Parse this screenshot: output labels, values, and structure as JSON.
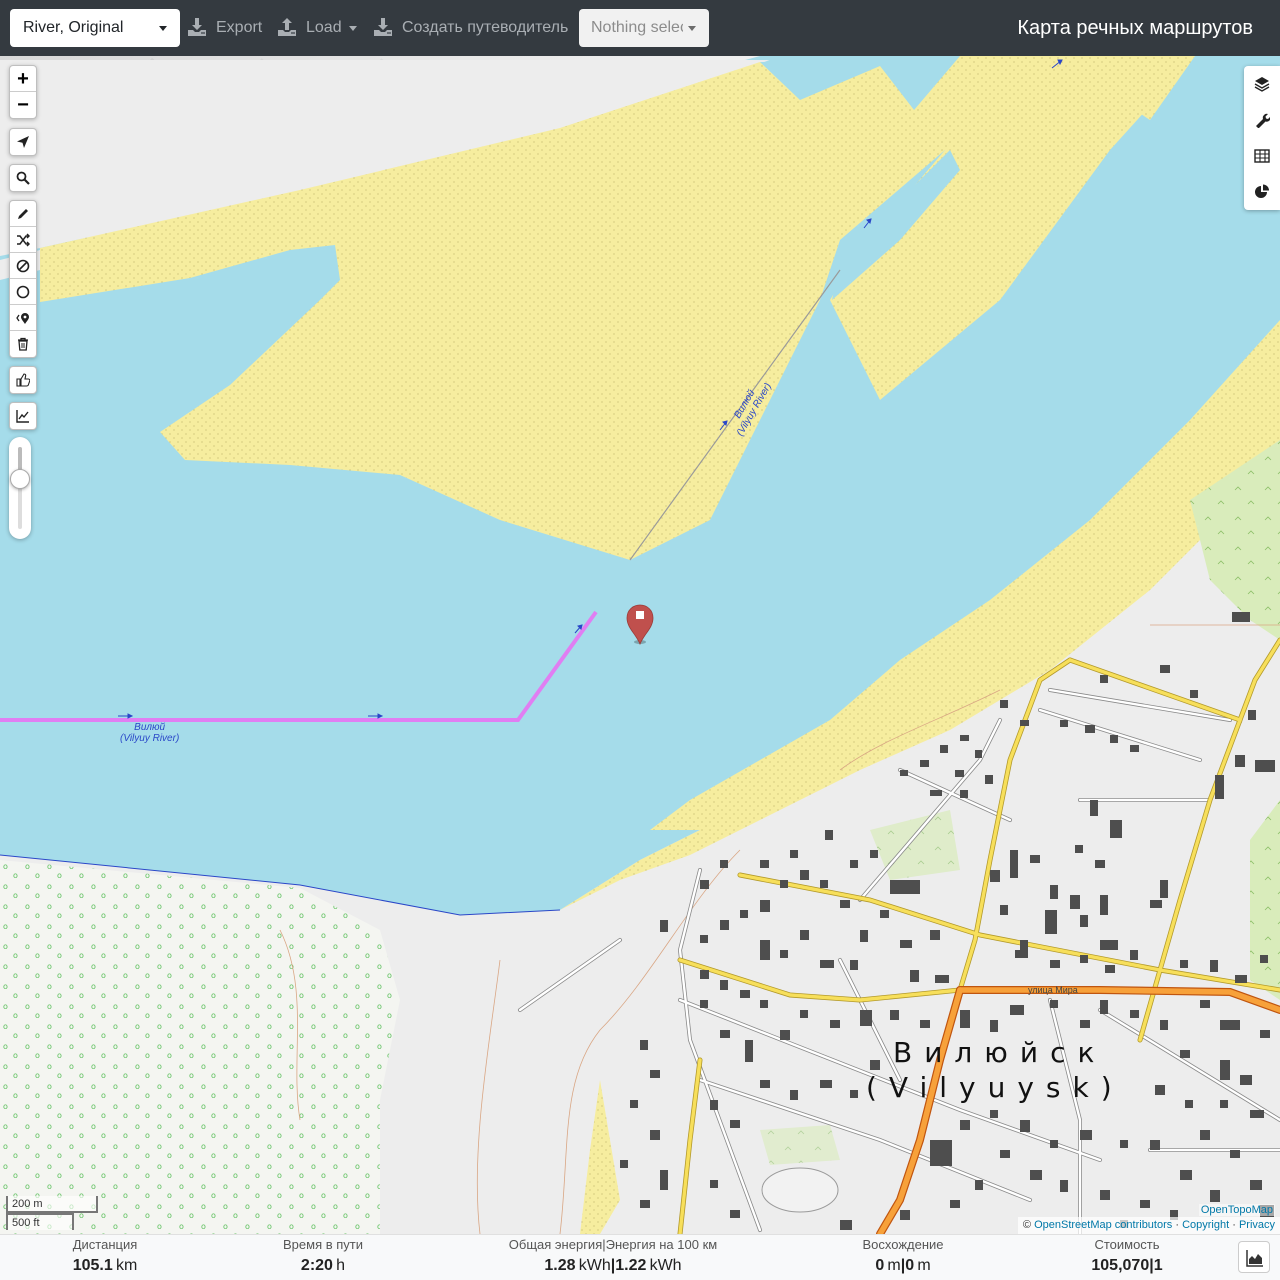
{
  "topbar": {
    "profile_select": "River, Original",
    "export_label": "Export",
    "load_label": "Load",
    "guide_label": "Создать путеводитель",
    "track_select": "Nothing selected",
    "app_title": "Карта речных маршрутов"
  },
  "map": {
    "city_label_ru": "Вилюйск",
    "city_label_en": "(Vilyuysk)",
    "river_label_1_ru": "Вилюй",
    "river_label_1_en": "(Vilyuy River)",
    "river_label_2_ru": "Вилюй",
    "river_label_2_en": "(Vilyuy River)",
    "street_label": "улица Мира",
    "scale_metric": "200 m",
    "scale_imperial": "500 ft",
    "tile_credit": "OpenTopoMap",
    "attribution": {
      "osm": "OpenStreetMap contributors",
      "copyright": "Copyright",
      "privacy": "Privacy",
      "separator": "·"
    },
    "controls": {
      "zoom_in": "+",
      "zoom_out": "−"
    },
    "route_color": "#e07ef2",
    "water_color": "#a5dcea",
    "sand_color": "#f6ed9f",
    "marker_color": "#c0504d"
  },
  "stats": {
    "distance": {
      "title": "Дистанция",
      "value": "105.1",
      "unit": "km"
    },
    "time": {
      "title": "Время в пути",
      "value": "2:20",
      "unit": "h"
    },
    "energy": {
      "title": "Общая энергия|Энергия на 100 км",
      "value1": "1.28",
      "unit1": "kWh",
      "sep": "|",
      "value2": "1.22",
      "unit2": "kWh"
    },
    "ascent": {
      "title": "Восхождение",
      "value1": "0",
      "unit1": "m",
      "sep": "|",
      "value2": "0",
      "unit2": "m"
    },
    "cost": {
      "title": "Стоимость",
      "value": "105,070",
      "sep": "|",
      "value2": "1"
    }
  }
}
